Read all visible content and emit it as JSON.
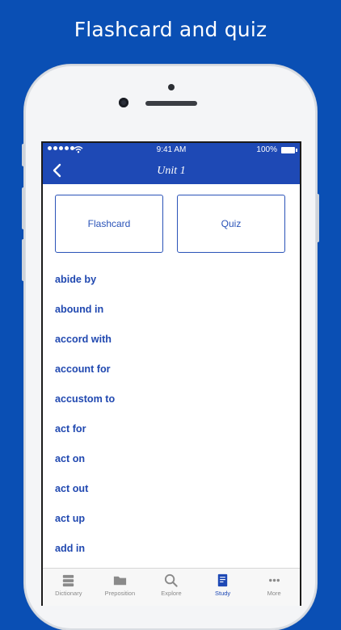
{
  "headline": "Flashcard and quiz",
  "status": {
    "time": "9:41 AM",
    "battery": "100%"
  },
  "nav": {
    "title": "Unit 1"
  },
  "cards": {
    "flashcard": "Flashcard",
    "quiz": "Quiz"
  },
  "words": [
    "abide by",
    "abound in",
    "accord with",
    "account for",
    "accustom to",
    "act for",
    "act on",
    "act out",
    "act up",
    "add in"
  ],
  "tabs": [
    {
      "label": "Dictionary",
      "icon": "dictionary-icon"
    },
    {
      "label": "Preposition",
      "icon": "folder-icon"
    },
    {
      "label": "Explore",
      "icon": "search-icon"
    },
    {
      "label": "Study",
      "icon": "study-icon",
      "active": true
    },
    {
      "label": "More",
      "icon": "more-icon"
    }
  ],
  "colors": {
    "background": "#0a4fb4",
    "accent": "#1e49b5",
    "link": "#2048b0"
  }
}
